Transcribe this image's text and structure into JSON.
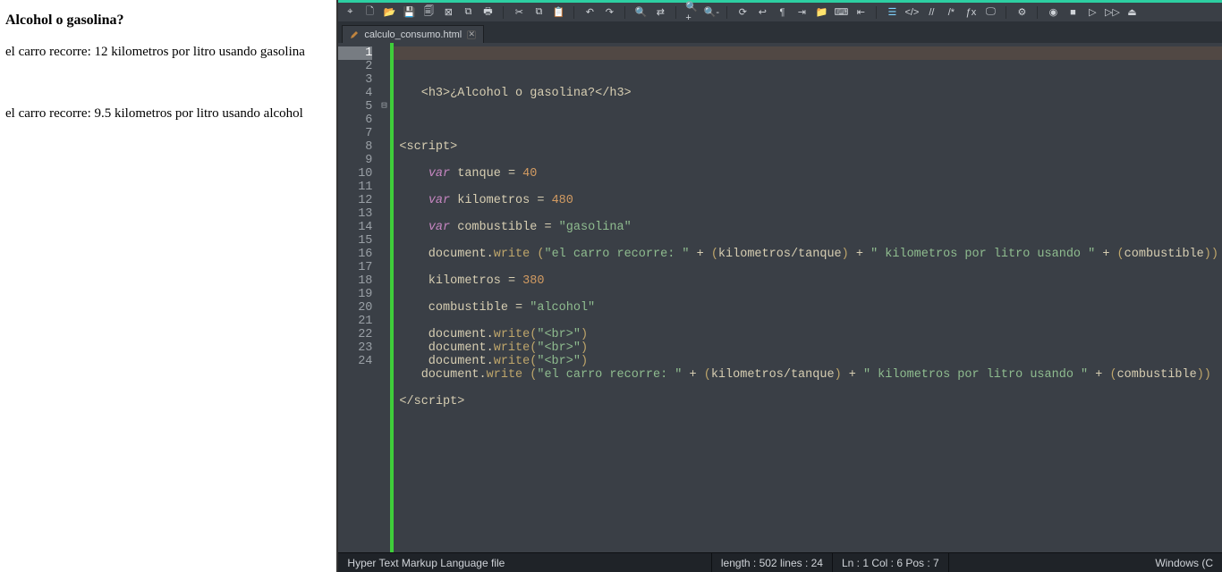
{
  "browser": {
    "title": "Alcohol o gasolina?",
    "line1": "el carro recorre: 12 kilometros por litro usando gasolina",
    "line2": "el carro recorre: 9.5 kilometros por litro usando alcohol"
  },
  "tab": {
    "filename": "calculo_consumo.html"
  },
  "code": {
    "lines": [
      {
        "n": 1,
        "tokens": [
          {
            "t": "   ",
            "c": ""
          },
          {
            "t": "<h3>",
            "c": "tag"
          },
          {
            "t": "¿Alcohol o gasolina?",
            "c": "nm"
          },
          {
            "t": "</h3>",
            "c": "tag"
          }
        ]
      },
      {
        "n": 2,
        "tokens": []
      },
      {
        "n": 3,
        "tokens": []
      },
      {
        "n": 4,
        "tokens": []
      },
      {
        "n": 5,
        "fold": "⊟",
        "tokens": [
          {
            "t": "<script>",
            "c": "tag"
          }
        ]
      },
      {
        "n": 6,
        "tokens": []
      },
      {
        "n": 7,
        "tokens": [
          {
            "t": "    ",
            "c": ""
          },
          {
            "t": "var",
            "c": "kw"
          },
          {
            "t": " tanque ",
            "c": "nm"
          },
          {
            "t": "=",
            "c": "op"
          },
          {
            "t": " ",
            "c": ""
          },
          {
            "t": "40",
            "c": "num"
          }
        ]
      },
      {
        "n": 8,
        "tokens": []
      },
      {
        "n": 9,
        "tokens": [
          {
            "t": "    ",
            "c": ""
          },
          {
            "t": "var",
            "c": "kw"
          },
          {
            "t": " kilometros ",
            "c": "nm"
          },
          {
            "t": "=",
            "c": "op"
          },
          {
            "t": " ",
            "c": ""
          },
          {
            "t": "480",
            "c": "num"
          }
        ]
      },
      {
        "n": 10,
        "tokens": []
      },
      {
        "n": 11,
        "tokens": [
          {
            "t": "    ",
            "c": ""
          },
          {
            "t": "var",
            "c": "kw"
          },
          {
            "t": " combustible ",
            "c": "nm"
          },
          {
            "t": "=",
            "c": "op"
          },
          {
            "t": " ",
            "c": ""
          },
          {
            "t": "\"gasolina\"",
            "c": "str"
          }
        ]
      },
      {
        "n": 12,
        "tokens": []
      },
      {
        "n": 13,
        "tokens": [
          {
            "t": "    document",
            "c": "obj"
          },
          {
            "t": ".",
            "c": "op"
          },
          {
            "t": "write",
            "c": "func"
          },
          {
            "t": " ",
            "c": ""
          },
          {
            "t": "(",
            "c": "paren"
          },
          {
            "t": "\"el carro recorre: \"",
            "c": "str"
          },
          {
            "t": " + ",
            "c": "op"
          },
          {
            "t": "(",
            "c": "paren"
          },
          {
            "t": "kilometros",
            "c": "nm"
          },
          {
            "t": "/",
            "c": "op"
          },
          {
            "t": "tanque",
            "c": "nm"
          },
          {
            "t": ")",
            "c": "paren"
          },
          {
            "t": " + ",
            "c": "op"
          },
          {
            "t": "\" kilometros por litro usando \"",
            "c": "str"
          },
          {
            "t": " + ",
            "c": "op"
          },
          {
            "t": "(",
            "c": "paren"
          },
          {
            "t": "combustible",
            "c": "nm"
          },
          {
            "t": ")",
            "c": "paren"
          },
          {
            "t": ")",
            "c": "paren"
          }
        ]
      },
      {
        "n": 14,
        "tokens": []
      },
      {
        "n": 15,
        "tokens": [
          {
            "t": "    kilometros ",
            "c": "nm"
          },
          {
            "t": "=",
            "c": "op"
          },
          {
            "t": " ",
            "c": ""
          },
          {
            "t": "380",
            "c": "num"
          }
        ]
      },
      {
        "n": 16,
        "tokens": []
      },
      {
        "n": 17,
        "tokens": [
          {
            "t": "    combustible ",
            "c": "nm"
          },
          {
            "t": "=",
            "c": "op"
          },
          {
            "t": " ",
            "c": ""
          },
          {
            "t": "\"alcohol\"",
            "c": "str"
          }
        ]
      },
      {
        "n": 18,
        "tokens": []
      },
      {
        "n": 19,
        "tokens": [
          {
            "t": "    document",
            "c": "obj"
          },
          {
            "t": ".",
            "c": "op"
          },
          {
            "t": "write",
            "c": "func"
          },
          {
            "t": "(",
            "c": "paren"
          },
          {
            "t": "\"<br>\"",
            "c": "str"
          },
          {
            "t": ")",
            "c": "paren"
          }
        ]
      },
      {
        "n": 20,
        "tokens": [
          {
            "t": "    document",
            "c": "obj"
          },
          {
            "t": ".",
            "c": "op"
          },
          {
            "t": "write",
            "c": "func"
          },
          {
            "t": "(",
            "c": "paren"
          },
          {
            "t": "\"<br>\"",
            "c": "str"
          },
          {
            "t": ")",
            "c": "paren"
          }
        ]
      },
      {
        "n": 21,
        "tokens": [
          {
            "t": "    document",
            "c": "obj"
          },
          {
            "t": ".",
            "c": "op"
          },
          {
            "t": "write",
            "c": "func"
          },
          {
            "t": "(",
            "c": "paren"
          },
          {
            "t": "\"<br>\"",
            "c": "str"
          },
          {
            "t": ")",
            "c": "paren"
          }
        ]
      },
      {
        "n": 22,
        "tokens": [
          {
            "t": "   document",
            "c": "obj"
          },
          {
            "t": ".",
            "c": "op"
          },
          {
            "t": "write",
            "c": "func"
          },
          {
            "t": " ",
            "c": ""
          },
          {
            "t": "(",
            "c": "paren"
          },
          {
            "t": "\"el carro recorre: \"",
            "c": "str"
          },
          {
            "t": " + ",
            "c": "op"
          },
          {
            "t": "(",
            "c": "paren"
          },
          {
            "t": "kilometros",
            "c": "nm"
          },
          {
            "t": "/",
            "c": "op"
          },
          {
            "t": "tanque",
            "c": "nm"
          },
          {
            "t": ")",
            "c": "paren"
          },
          {
            "t": " + ",
            "c": "op"
          },
          {
            "t": "\" kilometros por litro usando \"",
            "c": "str"
          },
          {
            "t": " + ",
            "c": "op"
          },
          {
            "t": "(",
            "c": "paren"
          },
          {
            "t": "combustible",
            "c": "nm"
          },
          {
            "t": ")",
            "c": "paren"
          },
          {
            "t": ")",
            "c": "paren"
          }
        ]
      },
      {
        "n": 23,
        "tokens": []
      },
      {
        "n": 24,
        "tokens": [
          {
            "t": "<",
            "c": "tag"
          },
          {
            "t": "/script>",
            "c": "tag"
          }
        ]
      }
    ]
  },
  "status": {
    "filetype": "Hyper Text Markup Language file",
    "length": "length : 502    lines : 24",
    "pos": "Ln : 1    Col : 6    Pos : 7",
    "encoding": "Windows (C"
  },
  "toolbar_icons": [
    "target",
    "new",
    "open",
    "save",
    "saveall",
    "close",
    "closeall",
    "print",
    "cut",
    "copy",
    "paste",
    "undo",
    "redo",
    "search",
    "replace",
    "zoomin",
    "zoomout",
    "sync",
    "wrap",
    "invisible",
    "indent",
    "folder",
    "lang",
    "outdent",
    "showall",
    "code",
    "comment",
    "uncomment",
    "func",
    "monitor",
    "settings",
    "record",
    "stop",
    "play",
    "ff",
    "macro"
  ]
}
